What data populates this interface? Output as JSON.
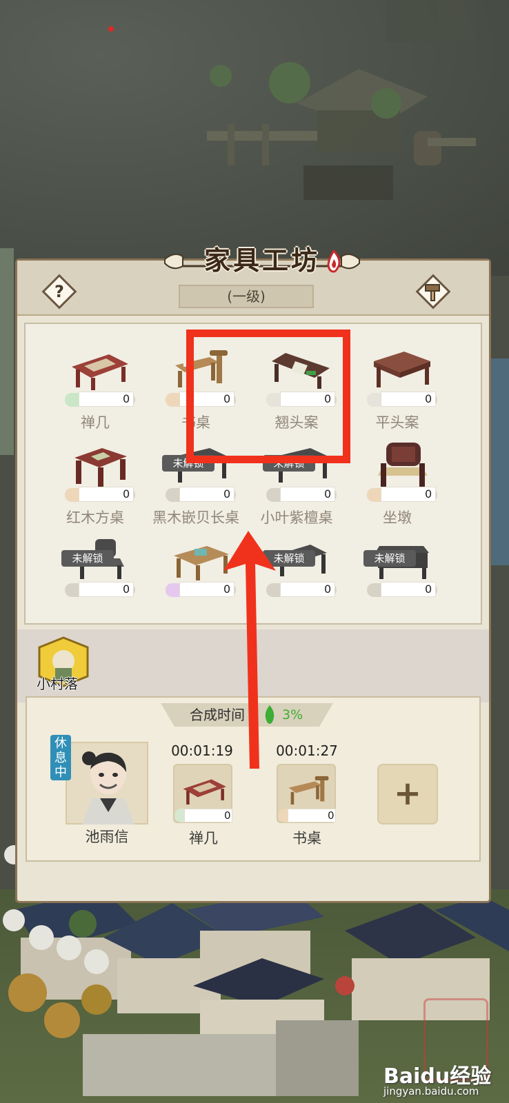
{
  "workshop": {
    "title": "家具工坊",
    "level": "(一级)",
    "help_glyph": "?"
  },
  "items": [
    {
      "name": "禅几",
      "count": "0",
      "locked": false,
      "accent": "#c9e7c6"
    },
    {
      "name": "书桌",
      "count": "0",
      "locked": false,
      "accent": "#eed7b8"
    },
    {
      "name": "翘头案",
      "count": "0",
      "locked": false,
      "accent": "#e6e3da"
    },
    {
      "name": "平头案",
      "count": "0",
      "locked": false,
      "accent": "#e6e3da"
    },
    {
      "name": "红木方桌",
      "count": "0",
      "locked": false,
      "accent": "#eed7b8"
    },
    {
      "name": "黑木嵌贝长桌",
      "count": "0",
      "locked": true,
      "lock_label": "未解锁"
    },
    {
      "name": "小叶紫檀桌",
      "count": "0",
      "locked": true,
      "lock_label": "未解锁"
    },
    {
      "name": "坐墩",
      "count": "0",
      "locked": false,
      "accent": "#eed7b8"
    },
    {
      "name": "",
      "count": "0",
      "locked": true,
      "lock_label": "未解锁"
    },
    {
      "name": "",
      "count": "0",
      "locked": false,
      "accent": "#e4c8ee"
    },
    {
      "name": "",
      "count": "0",
      "locked": true,
      "lock_label": "未解锁"
    },
    {
      "name": "",
      "count": "0",
      "locked": true,
      "lock_label": "未解锁"
    }
  ],
  "village": {
    "label": "小村落"
  },
  "crafting": {
    "time_label": "合成时间",
    "bonus_percent": "3%",
    "worker": {
      "name": "池雨信",
      "status": "休息中"
    },
    "slots": [
      {
        "timer": "00:01:19",
        "name": "禅几",
        "count": "0"
      },
      {
        "timer": "00:01:27",
        "name": "书桌",
        "count": "0"
      }
    ],
    "add_glyph": "+"
  },
  "watermark": {
    "brand": "Baidu经验",
    "url": "jingyan.baidu.com"
  }
}
